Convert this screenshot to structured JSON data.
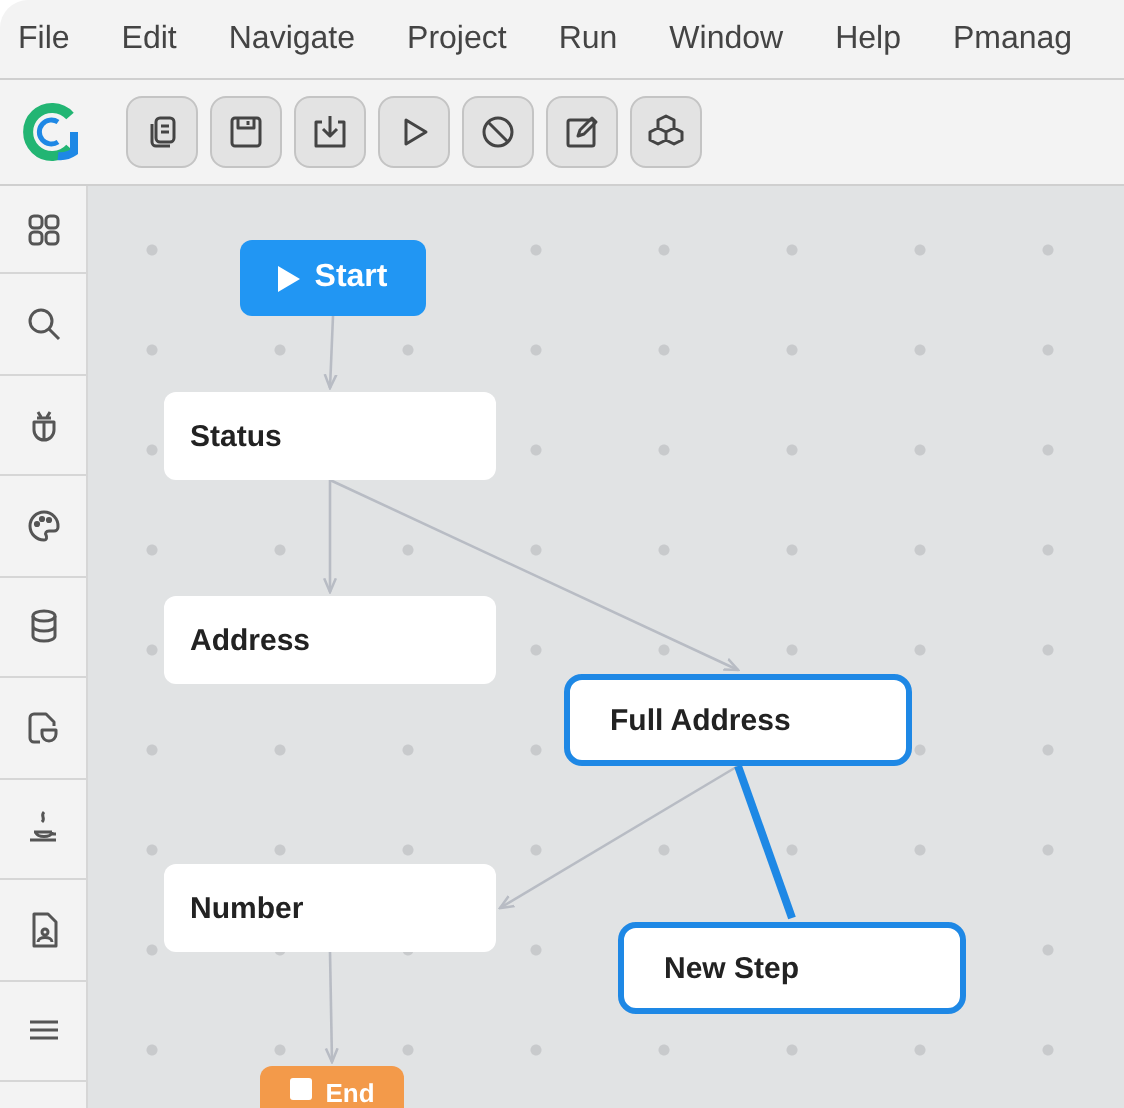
{
  "menu": [
    "File",
    "Edit",
    "Navigate",
    "Project",
    "Run",
    "Window",
    "Help",
    "Pmanag"
  ],
  "nodes": [
    {
      "label": "Start",
      "kind": "start",
      "selected": false
    },
    {
      "label": "Status",
      "kind": "step",
      "selected": false
    },
    {
      "label": "Address",
      "kind": "step",
      "selected": false
    },
    {
      "label": "Full Address",
      "kind": "step",
      "selected": true
    },
    {
      "label": "Number",
      "kind": "step",
      "selected": false
    },
    {
      "label": "New Step",
      "kind": "step",
      "selected": true
    },
    {
      "label": "End",
      "kind": "end",
      "selected": false
    }
  ]
}
